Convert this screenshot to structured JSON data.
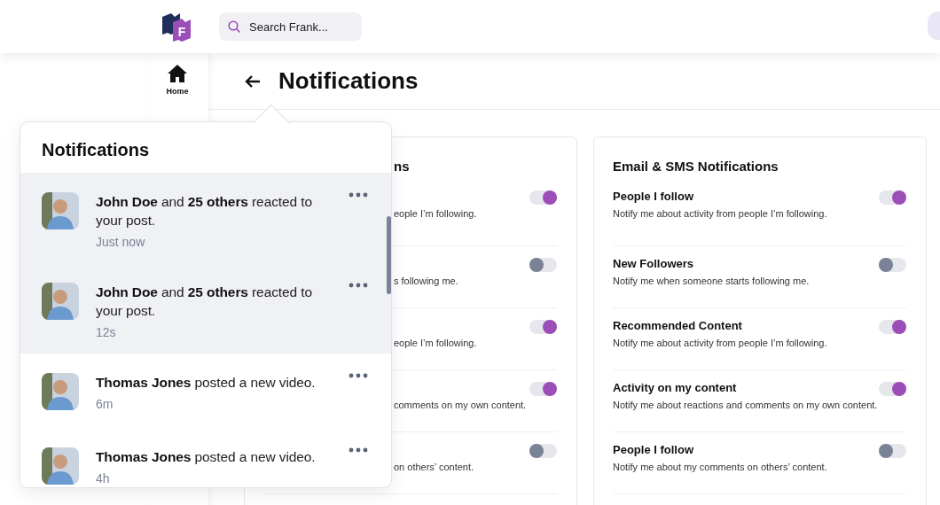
{
  "header": {
    "logo_letter": "F",
    "search": {
      "placeholder": "Search Frank..."
    }
  },
  "sidebar": {
    "items": [
      {
        "label": "Home",
        "selected": true
      }
    ]
  },
  "page": {
    "title": "Notifications"
  },
  "cards": [
    {
      "kind": "covered",
      "title": "ns",
      "rows": [
        {
          "description": "eople I’m following.",
          "on": true
        },
        {
          "description": "s following me.",
          "on": false
        },
        {
          "description": "eople I’m following.",
          "on": true
        },
        {
          "description": "comments on my own content.",
          "on": true
        },
        {
          "description": "on others’ content.",
          "on": false
        }
      ]
    },
    {
      "kind": "full",
      "title": "Email & SMS Notifications",
      "rows": [
        {
          "title": "People I follow",
          "description": "Notify me about activity from people I’m following.",
          "on": true
        },
        {
          "title": "New Followers",
          "description": "Notify me when someone starts following me.",
          "on": false
        },
        {
          "title": "Recommended Content",
          "description": "Notify me about activity from people I’m following.",
          "on": true
        },
        {
          "title": "Activity on my content",
          "description": "Notify me about reactions and comments on my own content.",
          "on": true
        },
        {
          "title": "People I follow",
          "description": "Notify me about my comments on others’ content.",
          "on": false
        }
      ]
    }
  ],
  "popup": {
    "title": "Notifications",
    "items": [
      {
        "text": "**John Doe** and **25 others** reacted to your post.",
        "time": "Just now",
        "unread": true
      },
      {
        "text": "**John Doe** and **25 others** reacted to your post.",
        "time": "12s",
        "unread": true
      },
      {
        "text": "**Thomas Jones** posted a new video.",
        "time": "6m",
        "unread": false
      },
      {
        "text": "**Thomas Jones** posted a new video.",
        "time": "4h",
        "unread": false
      }
    ]
  }
}
